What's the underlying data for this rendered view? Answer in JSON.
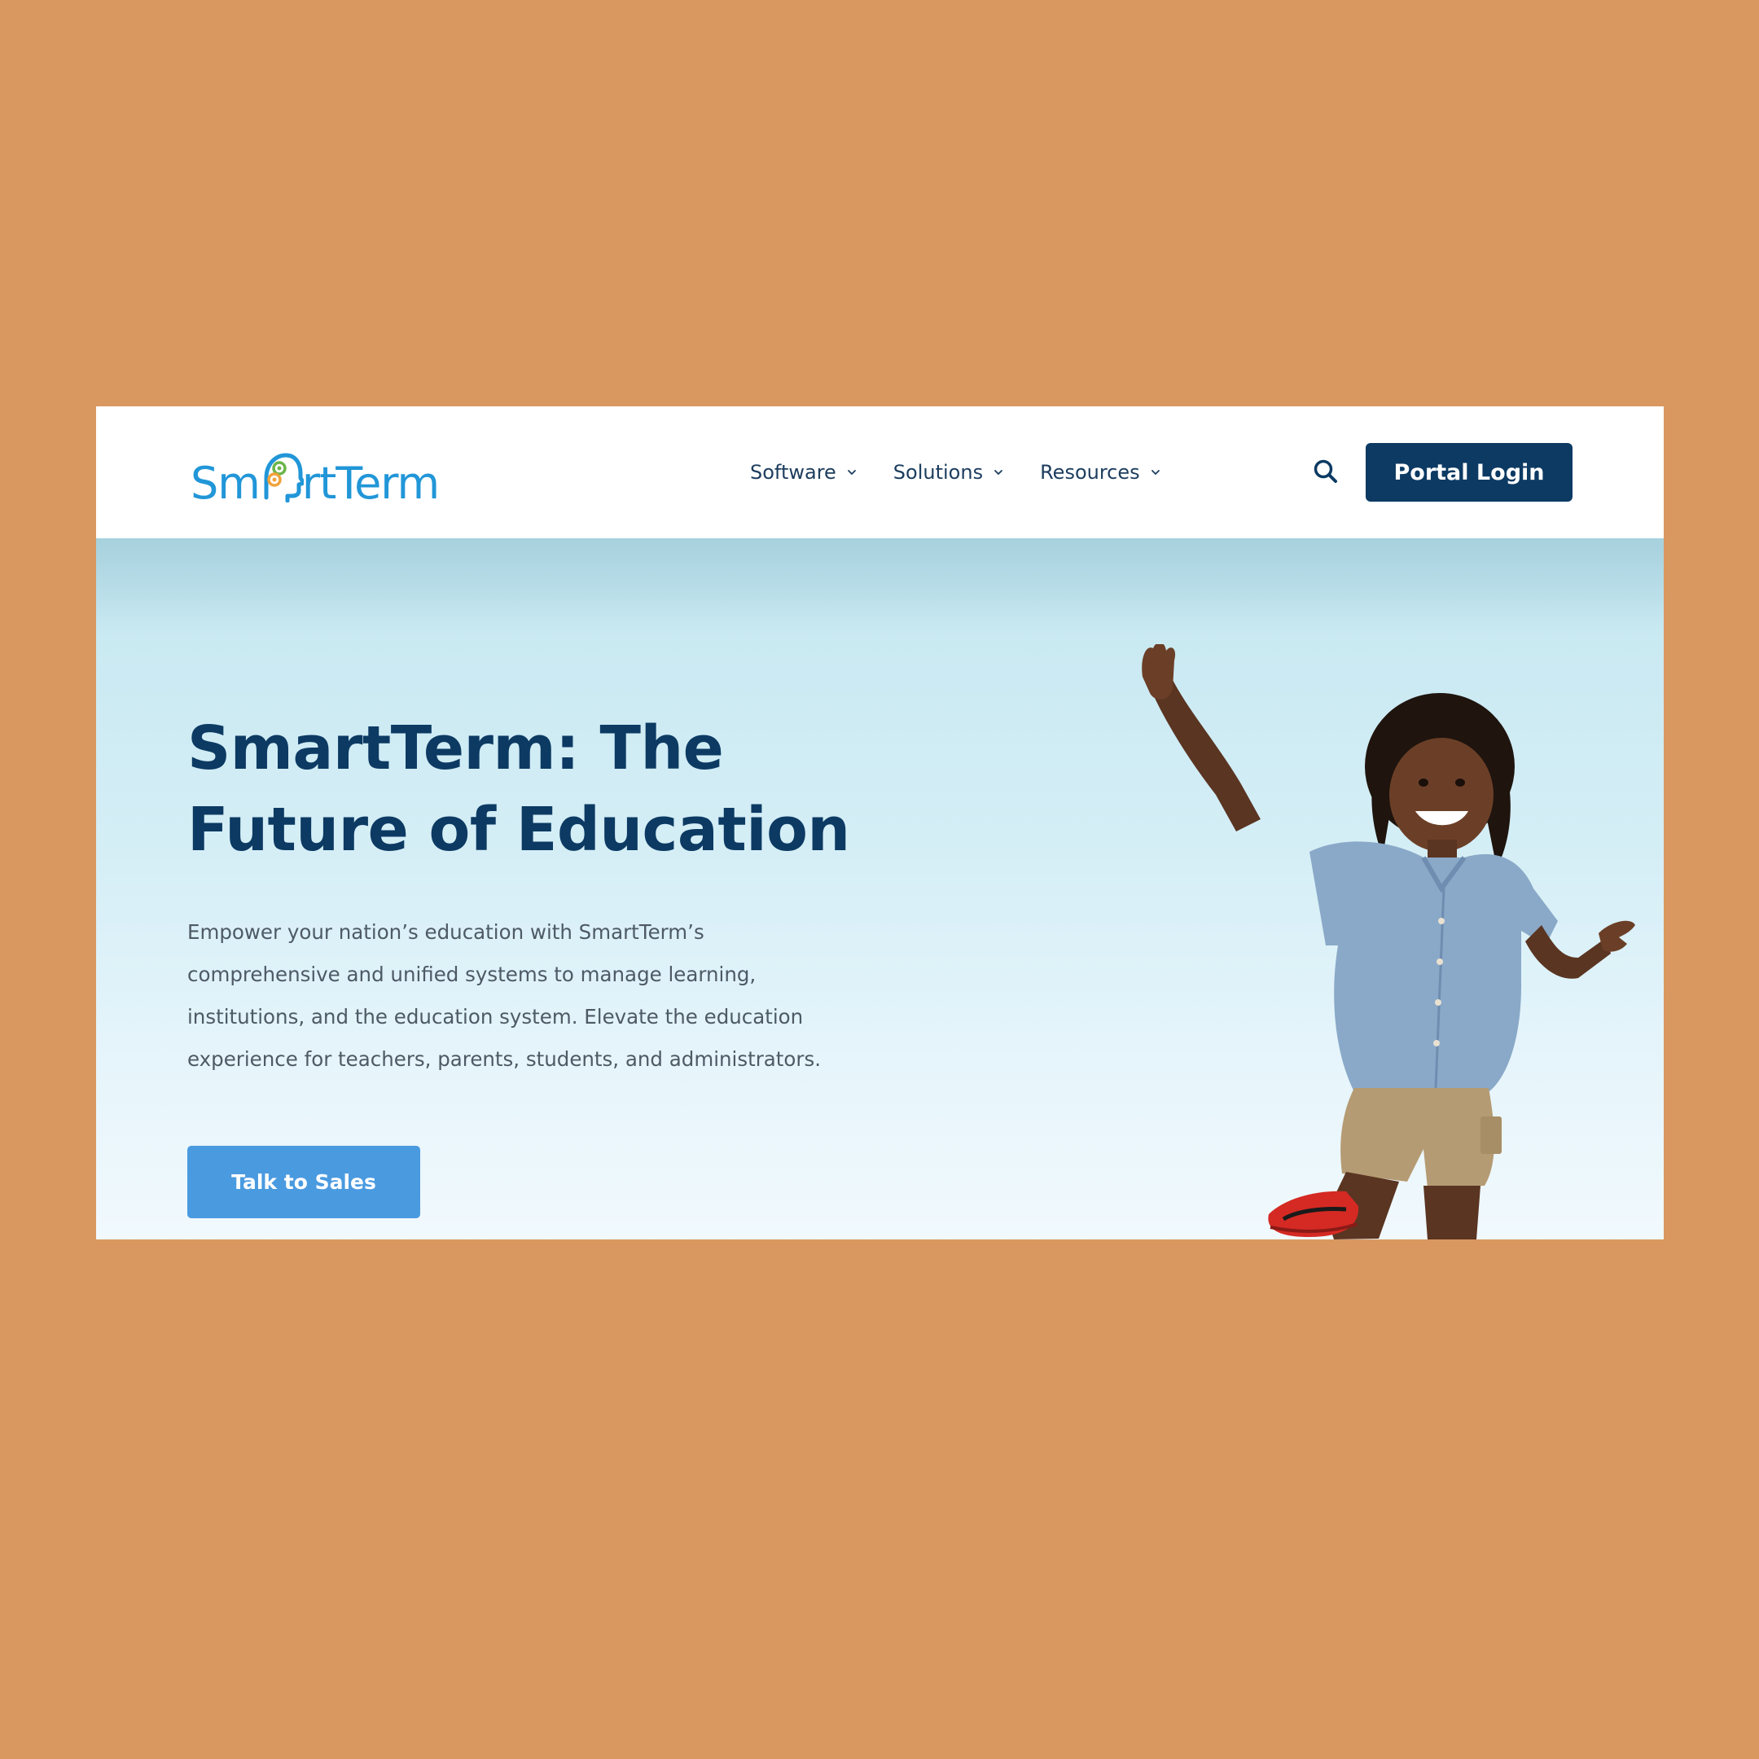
{
  "brand": {
    "name_part1": "Sm",
    "name_part2": "rtTerm",
    "logo_icon": "head-gears-icon",
    "color_primary": "#2196d8"
  },
  "nav": {
    "items": [
      {
        "label": "Software",
        "icon": "chevron-down-icon"
      },
      {
        "label": "Solutions",
        "icon": "chevron-down-icon"
      },
      {
        "label": "Resources",
        "icon": "chevron-down-icon"
      }
    ],
    "search_icon": "search-icon",
    "portal_label": "Portal Login"
  },
  "hero": {
    "title_line1": "SmartTerm: The",
    "title_line2": "Future of Education",
    "description": "Empower your nation’s education with SmartTerm’s comprehensive and unified systems to manage learning, institutions, and the education system. Elevate the education experience for teachers, parents, students, and administrators.",
    "cta_label": "Talk to Sales",
    "image": "smiling-child-photo"
  },
  "colors": {
    "page_background": "#d99860",
    "navy": "#0c3a63",
    "cta_blue": "#4a9ae0"
  }
}
